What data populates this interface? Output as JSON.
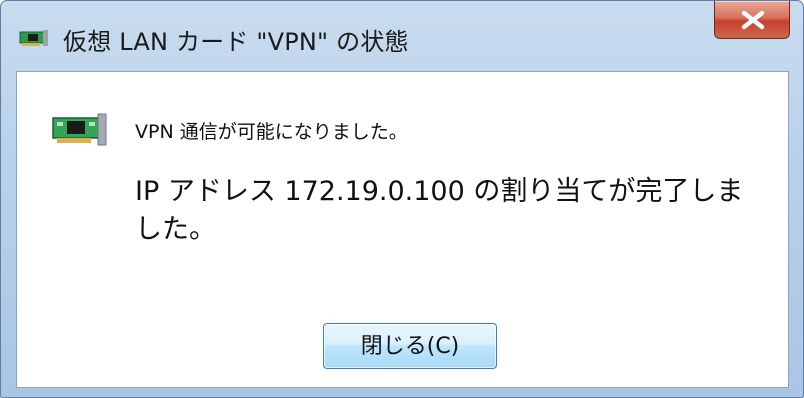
{
  "window": {
    "title": "仮想 LAN カード \"VPN\" の状態",
    "title_icon": "network-card-icon",
    "close_icon": "close-icon"
  },
  "message": {
    "icon": "network-card-icon",
    "line1": "VPN 通信が可能になりました。",
    "line2": "IP アドレス 172.19.0.100 の割り当てが完了しました。"
  },
  "buttons": {
    "close_label": "閉じる(C)"
  },
  "colors": {
    "close_button": "#c94a35",
    "accent_border": "#3c7fb1",
    "window_frame": "#b9d1ea"
  }
}
